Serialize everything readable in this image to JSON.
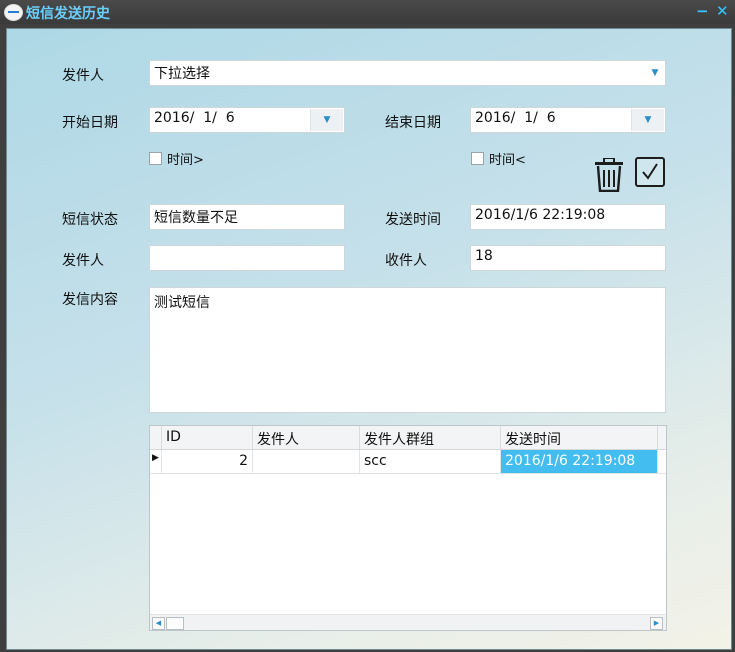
{
  "window": {
    "title": "短信发送历史",
    "min_label": "−",
    "close_label": "✕"
  },
  "form": {
    "sender_label": "发件人",
    "sender_select_value": "下拉选择",
    "start_date_label": "开始日期",
    "start_date_value": "2016/  1/  6",
    "end_date_label": "结束日期",
    "end_date_value": "2016/  1/  6",
    "time_gt_label": "时间>",
    "time_lt_label": "时间<",
    "sms_status_label": "短信状态",
    "sms_status_value": "短信数量不足",
    "send_time_label": "发送时间",
    "send_time_value": "2016/1/6 22:19:08",
    "sender2_label": "发件人",
    "sender2_value": "",
    "recipient_label": "收件人",
    "recipient_value": "18",
    "content_label": "发信内容",
    "content_value": "测试短信"
  },
  "grid": {
    "columns": [
      "ID",
      "发件人",
      "发件人群组",
      "发送时间",
      ""
    ],
    "rows": [
      {
        "id": "2",
        "sender": "",
        "group": "scc",
        "send_time": "2016/1/6 22:19:08",
        "extra": ""
      }
    ]
  },
  "icons": {
    "trash": "trash-icon",
    "confirm": "checkmark-icon",
    "dropdown": "chevron-down-icon",
    "row_indicator": "triangle-right-icon"
  },
  "colors": {
    "title": "#6ad0ff",
    "selected_cell": "#43bdf0",
    "accent": "#2a8fc9"
  }
}
